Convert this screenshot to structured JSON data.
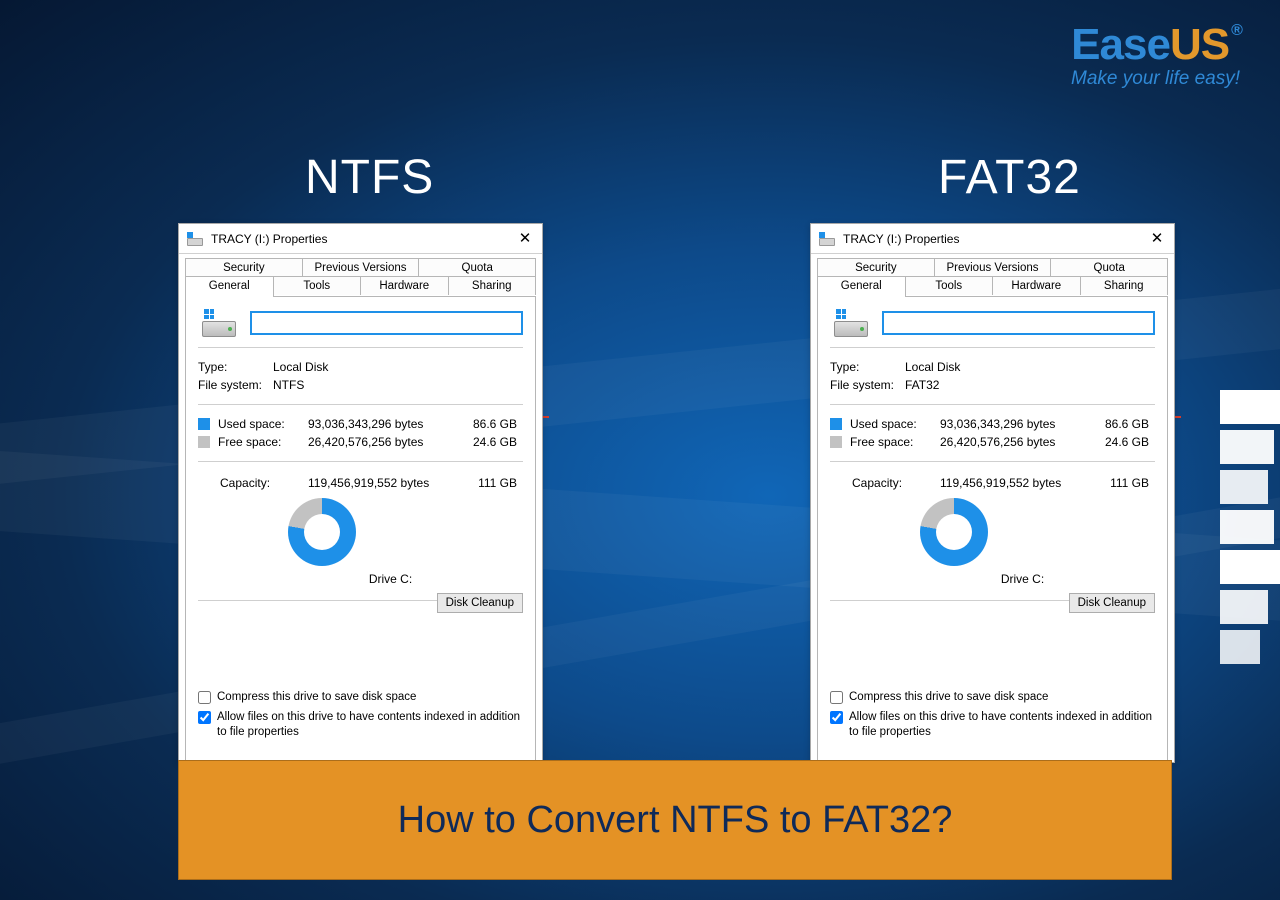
{
  "logo": {
    "ease": "Ease",
    "us": "US",
    "reg": "®",
    "tagline": "Make your life easy!"
  },
  "labels": {
    "left": "NTFS",
    "right": "FAT32"
  },
  "banner": "How to Convert NTFS to FAT32?",
  "dialog": {
    "title": "TRACY (I:) Properties",
    "tabs_back": [
      "Security",
      "Previous Versions",
      "Quota"
    ],
    "tabs_front": [
      "General",
      "Tools",
      "Hardware",
      "Sharing"
    ],
    "type_label": "Type:",
    "type_value": "Local Disk",
    "fs_label": "File system:",
    "used_label": "Used space:",
    "used_bytes": "93,036,343,296 bytes",
    "used_gb": "86.6 GB",
    "free_label": "Free space:",
    "free_bytes": "26,420,576,256 bytes",
    "free_gb": "24.6 GB",
    "cap_label": "Capacity:",
    "cap_bytes": "119,456,919,552 bytes",
    "cap_gb": "111 GB",
    "drive_label": "Drive C:",
    "cleanup": "Disk Cleanup",
    "check_compress": "Compress this drive to save disk space",
    "check_index": "Allow files on this drive to have contents indexed in addition to file properties"
  },
  "left": {
    "fs_value": "NTFS"
  },
  "right": {
    "fs_value": "FAT32"
  }
}
